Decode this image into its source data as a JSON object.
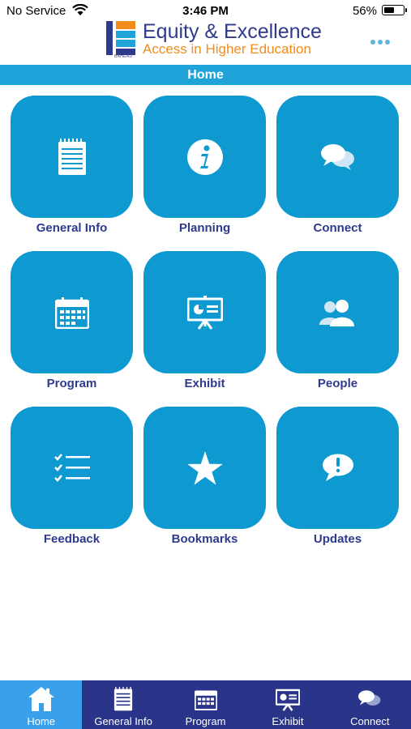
{
  "status_bar": {
    "carrier": "No Service",
    "time": "3:46 PM",
    "battery_percent": "56%",
    "battery_level": 0.56
  },
  "header": {
    "logo_line1": "Equity & Excellence",
    "logo_line2": "Access in Higher Education",
    "logo_tag": "BAHEAD",
    "more_icon": "ellipsis-icon"
  },
  "page": {
    "title": "Home"
  },
  "tiles": [
    {
      "label": "General Info",
      "icon": "notepad-icon"
    },
    {
      "label": "Planning",
      "icon": "info-icon"
    },
    {
      "label": "Connect",
      "icon": "chat-bubbles-icon"
    },
    {
      "label": "Program",
      "icon": "calendar-icon"
    },
    {
      "label": "Exhibit",
      "icon": "presentation-board-icon"
    },
    {
      "label": "People",
      "icon": "people-icon"
    },
    {
      "label": "Feedback",
      "icon": "checklist-icon"
    },
    {
      "label": "Bookmarks",
      "icon": "star-icon"
    },
    {
      "label": "Updates",
      "icon": "alert-bubble-icon"
    }
  ],
  "tab_bar": [
    {
      "label": "Home",
      "icon": "home-icon",
      "active": true
    },
    {
      "label": "General Info",
      "icon": "notepad-icon"
    },
    {
      "label": "Program",
      "icon": "calendar-icon"
    },
    {
      "label": "Exhibit",
      "icon": "presentation-board-icon"
    },
    {
      "label": "Connect",
      "icon": "chat-bubbles-icon"
    }
  ],
  "colors": {
    "tile": "#0e9ad1",
    "title_bar": "#1fa3d8",
    "tab_bar": "#2a3589",
    "tab_active": "#3aa0eb",
    "brand_blue": "#2e3a8c",
    "brand_orange": "#f28c1b"
  }
}
